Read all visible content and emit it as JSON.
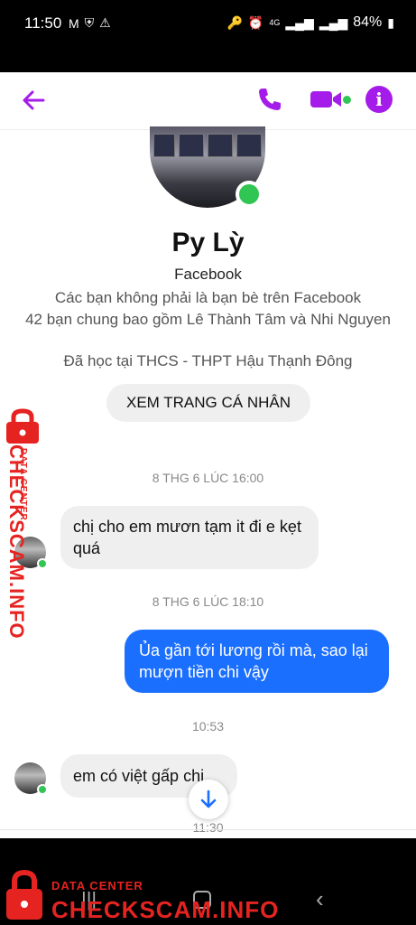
{
  "status_bar": {
    "time": "11:50",
    "battery": "84%",
    "network": "4G"
  },
  "header": {
    "back_icon": "arrow-left-icon",
    "call_icon": "phone-icon",
    "video_icon": "video-camera-icon",
    "info_icon": "info-icon",
    "info_glyph": "i",
    "accent_color": "#a51bea"
  },
  "profile": {
    "name": "Py Lỳ",
    "source": "Facebook",
    "not_friends": "Các bạn không phải là bạn bè trên Facebook",
    "mutual_friends": "42 bạn chung bao gồm Lê Thành Tâm và Nhi Nguyen",
    "education": "Đã học tại THCS - THPT Hậu Thạnh Đông",
    "view_profile_button": "XEM TRANG CÁ NHÂN"
  },
  "messages": [
    {
      "timestamp": "8 THG 6 LÚC 16:00"
    },
    {
      "direction": "incoming",
      "text": "chị cho em mươn tạm it đi e kẹt quá"
    },
    {
      "timestamp": "8 THG 6 LÚC 18:10"
    },
    {
      "direction": "outgoing",
      "text": "Ủa gần tới lương rồi mà, sao lại mượn tiền chi vậy"
    },
    {
      "timestamp": "10:53"
    },
    {
      "direction": "incoming",
      "text": "em có việt gấp chị"
    },
    {
      "timestamp": "11:30"
    }
  ],
  "colors": {
    "outgoing_bubble": "#1b6fff",
    "incoming_bubble": "#efefef",
    "online": "#31c553",
    "watermark": "#e52421"
  },
  "watermark": {
    "main": "CHECKSCAM.INFO",
    "sub": "DATA CENTER"
  }
}
